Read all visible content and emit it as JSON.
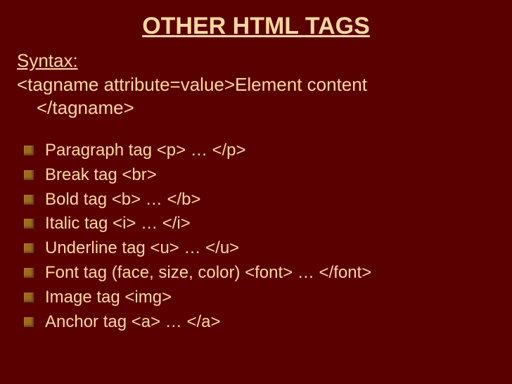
{
  "title": "OTHER HTML TAGS",
  "syntax_label": "Syntax:",
  "syntax_line1": "<tagname attribute=value>Element content",
  "syntax_line2": "</tagname>",
  "bullets": [
    "Paragraph tag  <p>  …  </p>",
    "Break tag  <br>",
    "Bold tag  <b> … </b>",
    "Italic tag  <i> … </i>",
    "Underline tag  <u> … </u>",
    "Font tag (face, size, color)  <font> … </font>",
    "Image tag  <img>",
    "Anchor tag <a> … </a>"
  ]
}
